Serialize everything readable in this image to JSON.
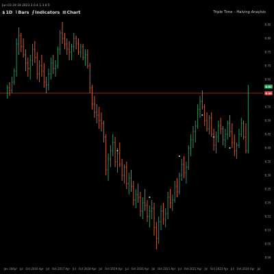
{
  "header": {
    "info_line": "Jan 03 29 19 2023 3 0.4 1.3 0.5",
    "tools": [
      {
        "icon": "$",
        "label": "1D",
        "name": "interval-button"
      },
      {
        "icon": "⌇",
        "label": "Bars",
        "name": "chart-type-button"
      },
      {
        "icon": "⨍",
        "label": "Indicators",
        "name": "indicators-button"
      },
      {
        "icon": "⊞",
        "label": "Chart",
        "name": "layout-button"
      }
    ],
    "indicator_label": "Triple Time – Halving Anaylsis"
  },
  "colors": {
    "background": "#000000",
    "up": "#2fa36b",
    "down": "#e46a3a",
    "dots": "#6ee7e0",
    "level_line": "#c0392b",
    "tag_green": "#2e9d5a",
    "tag_red": "#c43c2f"
  },
  "chart_data": {
    "type": "bar",
    "title": "",
    "xlabel": "",
    "ylabel": "",
    "x_ticks": [
      "Jan 30",
      "Apr",
      "Jul",
      "Oct",
      "2016",
      "Apr",
      "Jul",
      "Oct",
      "2017",
      "Apr",
      "Jul",
      "Oct",
      "2018",
      "Apr",
      "Jul",
      "Oct",
      "2019",
      "Apr",
      "Jul",
      "Oct",
      "2020",
      "Apr",
      "Jul",
      "Oct",
      "2021",
      "Apr",
      "Jul",
      "Oct",
      "2022",
      "Apr",
      "Jul",
      "Oct",
      "2023",
      "Apr",
      "Jul",
      "Oct",
      "2024",
      "Apr",
      "Jul"
    ],
    "y_ticks": [
      8.85,
      8.8,
      8.75,
      8.7,
      8.65,
      8.6,
      8.55,
      8.5,
      8.45,
      8.4,
      8.35,
      8.3,
      8.25,
      8.2,
      8.15,
      8.1,
      8.05,
      8.0
    ],
    "y_ticks_display": [
      "8.85",
      "8.80",
      "8.75",
      "8.70",
      "8.65",
      "8.60",
      "8.55",
      "8.50",
      "8.45",
      "8.40",
      "8.35",
      "8.30",
      "8.25",
      "8.20",
      "8.15",
      "8.10",
      "8.05",
      "8.00"
    ],
    "ylim": [
      7.98,
      8.88
    ],
    "level_line": 8.6,
    "tags": [
      {
        "label": "8.62",
        "value": 8.624,
        "color": "green"
      },
      {
        "label": "8.60",
        "value": 8.6,
        "color": "red"
      }
    ],
    "bars": [
      [
        8.6,
        8.63,
        8.58,
        8.62
      ],
      [
        8.62,
        8.64,
        8.59,
        8.61
      ],
      [
        8.61,
        8.66,
        8.6,
        8.64
      ],
      [
        8.64,
        8.69,
        8.63,
        8.68
      ],
      [
        8.68,
        8.8,
        8.66,
        8.78
      ],
      [
        8.78,
        8.84,
        8.74,
        8.81
      ],
      [
        8.81,
        8.82,
        8.75,
        8.77
      ],
      [
        8.77,
        8.8,
        8.73,
        8.74
      ],
      [
        8.74,
        8.76,
        8.68,
        8.71
      ],
      [
        8.71,
        8.73,
        8.66,
        8.69
      ],
      [
        8.69,
        8.74,
        8.65,
        8.72
      ],
      [
        8.72,
        8.78,
        8.7,
        8.76
      ],
      [
        8.76,
        8.79,
        8.71,
        8.73
      ],
      [
        8.73,
        8.75,
        8.65,
        8.67
      ],
      [
        8.67,
        8.72,
        8.64,
        8.7
      ],
      [
        8.7,
        8.74,
        8.66,
        8.68
      ],
      [
        8.68,
        8.71,
        8.62,
        8.64
      ],
      [
        8.64,
        8.66,
        8.6,
        8.63
      ],
      [
        8.63,
        8.69,
        8.61,
        8.67
      ],
      [
        8.67,
        8.73,
        8.65,
        8.71
      ],
      [
        8.71,
        8.74,
        8.67,
        8.69
      ],
      [
        8.69,
        8.72,
        8.66,
        8.7
      ],
      [
        8.7,
        8.77,
        8.69,
        8.76
      ],
      [
        8.76,
        8.83,
        8.74,
        8.82
      ],
      [
        8.82,
        8.86,
        8.78,
        8.8
      ],
      [
        8.8,
        8.82,
        8.76,
        8.78
      ],
      [
        8.78,
        8.8,
        8.74,
        8.76
      ],
      [
        8.76,
        8.79,
        8.72,
        8.75
      ],
      [
        8.75,
        8.78,
        8.72,
        8.77
      ],
      [
        8.77,
        8.82,
        8.75,
        8.8
      ],
      [
        8.8,
        8.81,
        8.76,
        8.78
      ],
      [
        8.78,
        8.8,
        8.74,
        8.75
      ],
      [
        8.75,
        8.78,
        8.73,
        8.77
      ],
      [
        8.77,
        8.78,
        8.72,
        8.73
      ],
      [
        8.73,
        8.76,
        8.7,
        8.74
      ],
      [
        8.74,
        8.76,
        8.69,
        8.7
      ],
      [
        8.7,
        8.71,
        8.6,
        8.62
      ],
      [
        8.62,
        8.63,
        8.54,
        8.56
      ],
      [
        8.56,
        8.59,
        8.51,
        8.53
      ],
      [
        8.53,
        8.56,
        8.49,
        8.52
      ],
      [
        8.52,
        8.55,
        8.47,
        8.5
      ],
      [
        8.5,
        8.53,
        8.46,
        8.49
      ],
      [
        8.49,
        8.5,
        8.42,
        8.44
      ],
      [
        8.44,
        8.45,
        8.3,
        8.32
      ],
      [
        8.32,
        8.38,
        8.28,
        8.36
      ],
      [
        8.36,
        8.41,
        8.33,
        8.39
      ],
      [
        8.39,
        8.45,
        8.37,
        8.42
      ],
      [
        8.42,
        8.44,
        8.33,
        8.35
      ],
      [
        8.35,
        8.4,
        8.31,
        8.38
      ],
      [
        8.38,
        8.42,
        8.33,
        8.34
      ],
      [
        8.34,
        8.36,
        8.28,
        8.3
      ],
      [
        8.3,
        8.34,
        8.27,
        8.33
      ],
      [
        8.33,
        8.35,
        8.25,
        8.27
      ],
      [
        8.27,
        8.31,
        8.23,
        8.29
      ],
      [
        8.29,
        8.32,
        8.24,
        8.26
      ],
      [
        8.26,
        8.28,
        8.19,
        8.21
      ],
      [
        8.21,
        8.25,
        8.18,
        8.23
      ],
      [
        8.23,
        8.27,
        8.2,
        8.22
      ],
      [
        8.22,
        8.24,
        8.15,
        8.17
      ],
      [
        8.17,
        8.22,
        8.14,
        8.2
      ],
      [
        8.2,
        8.25,
        8.17,
        8.19
      ],
      [
        8.19,
        8.21,
        8.13,
        8.15
      ],
      [
        8.15,
        8.19,
        8.11,
        8.17
      ],
      [
        8.17,
        8.21,
        8.14,
        8.18
      ],
      [
        8.18,
        8.2,
        8.08,
        8.11
      ],
      [
        8.11,
        8.13,
        8.03,
        8.07
      ],
      [
        8.07,
        8.15,
        8.05,
        8.13
      ],
      [
        8.13,
        8.19,
        8.1,
        8.17
      ],
      [
        8.17,
        8.2,
        8.12,
        8.14
      ],
      [
        8.14,
        8.18,
        8.11,
        8.16
      ],
      [
        8.16,
        8.24,
        8.14,
        8.22
      ],
      [
        8.22,
        8.25,
        8.18,
        8.2
      ],
      [
        8.2,
        8.23,
        8.17,
        8.21
      ],
      [
        8.21,
        8.28,
        8.2,
        8.26
      ],
      [
        8.26,
        8.29,
        8.22,
        8.24
      ],
      [
        8.24,
        8.31,
        8.23,
        8.3
      ],
      [
        8.3,
        8.36,
        8.28,
        8.34
      ],
      [
        8.34,
        8.37,
        8.29,
        8.31
      ],
      [
        8.31,
        8.35,
        8.27,
        8.33
      ],
      [
        8.33,
        8.41,
        8.32,
        8.4
      ],
      [
        8.4,
        8.45,
        8.37,
        8.43
      ],
      [
        8.43,
        8.48,
        8.4,
        8.46
      ],
      [
        8.46,
        8.5,
        8.42,
        8.48
      ],
      [
        8.48,
        8.56,
        8.47,
        8.54
      ],
      [
        8.54,
        8.59,
        8.51,
        8.57
      ],
      [
        8.57,
        8.61,
        8.54,
        8.55
      ],
      [
        8.55,
        8.56,
        8.48,
        8.5
      ],
      [
        8.5,
        8.53,
        8.46,
        8.47
      ],
      [
        8.47,
        8.52,
        8.45,
        8.51
      ],
      [
        8.51,
        8.53,
        8.44,
        8.45
      ],
      [
        8.45,
        8.47,
        8.39,
        8.41
      ],
      [
        8.41,
        8.46,
        8.38,
        8.44
      ],
      [
        8.44,
        8.5,
        8.42,
        8.48
      ],
      [
        8.48,
        8.51,
        8.45,
        8.47
      ],
      [
        8.47,
        8.48,
        8.41,
        8.43
      ],
      [
        8.43,
        8.47,
        8.4,
        8.45
      ],
      [
        8.45,
        8.5,
        8.43,
        8.49
      ],
      [
        8.49,
        8.52,
        8.44,
        8.46
      ],
      [
        8.46,
        8.49,
        8.4,
        8.42
      ],
      [
        8.42,
        8.45,
        8.37,
        8.39
      ],
      [
        8.39,
        8.42,
        8.36,
        8.41
      ],
      [
        8.41,
        8.47,
        8.4,
        8.45
      ],
      [
        8.45,
        8.51,
        8.44,
        8.49
      ],
      [
        8.49,
        8.5,
        8.43,
        8.44
      ],
      [
        8.44,
        8.49,
        8.38,
        8.39
      ],
      [
        8.39,
        8.63,
        8.38,
        8.6
      ]
    ],
    "markers": [
      {
        "index": 48,
        "value": 8.39
      },
      {
        "index": 62,
        "value": 8.22
      },
      {
        "index": 75,
        "value": 8.37
      },
      {
        "index": 85,
        "value": 8.52
      },
      {
        "index": 90,
        "value": 8.44
      },
      {
        "index": 97,
        "value": 8.4
      }
    ]
  }
}
